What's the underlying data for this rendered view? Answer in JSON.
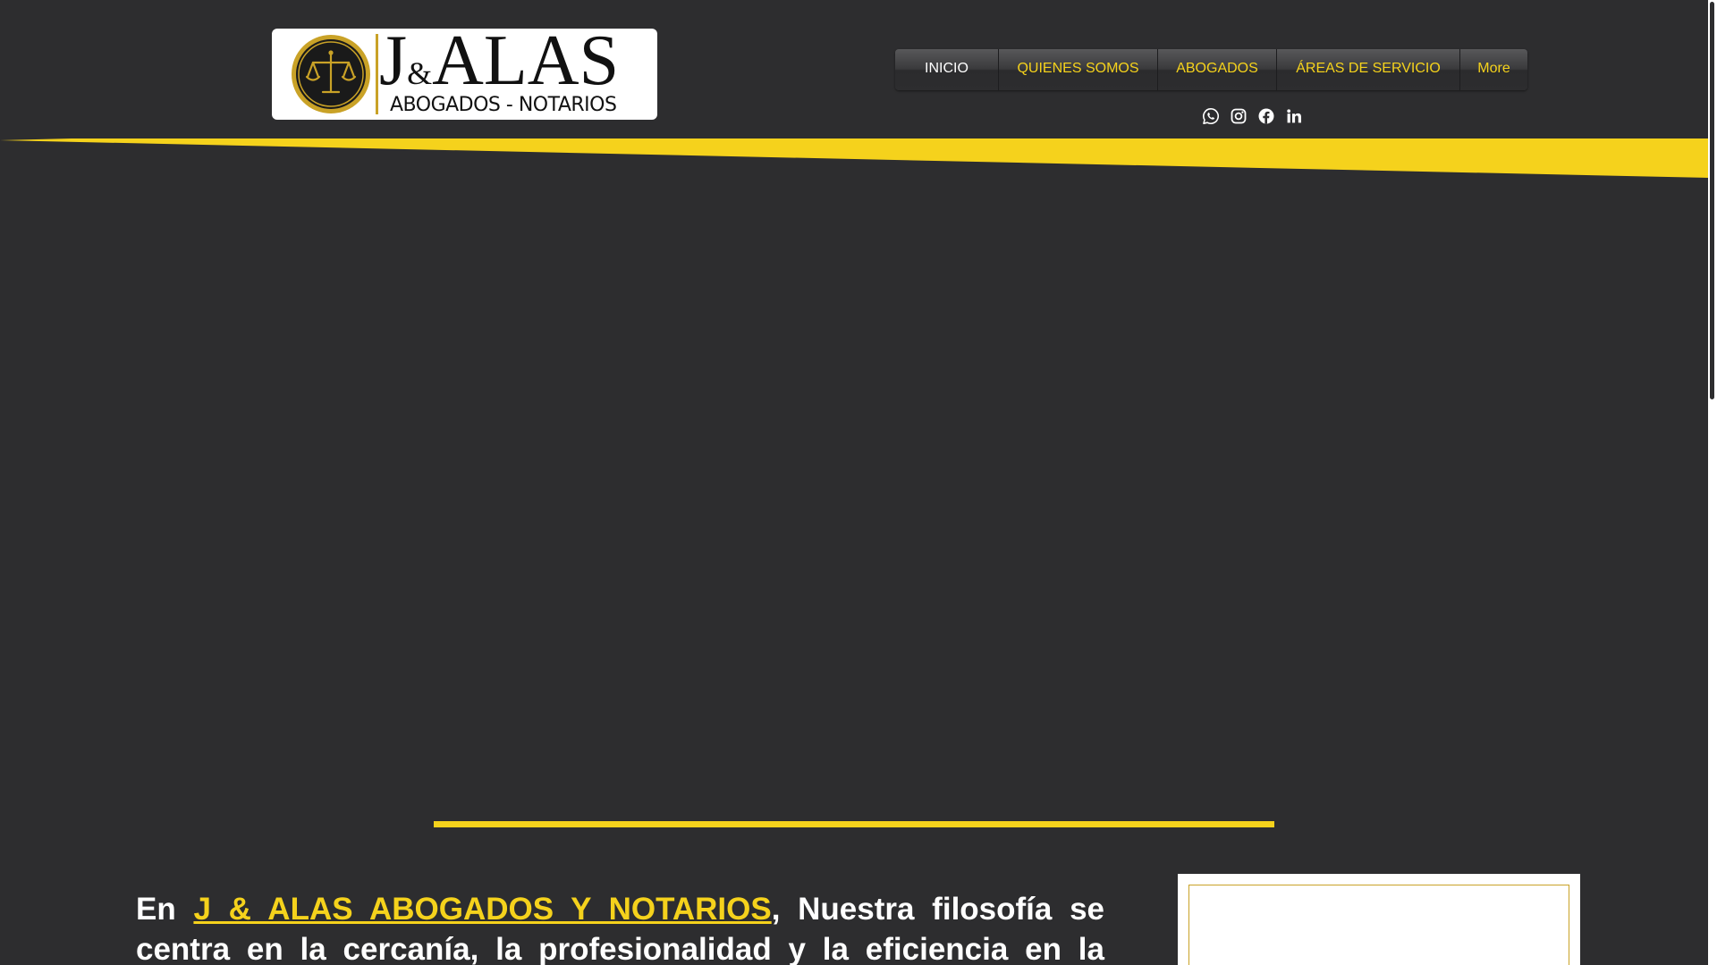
{
  "logo": {
    "main_j": "J",
    "main_amp": "&",
    "main_alas": "ALAS",
    "subtitle": "ABOGADOS - NOTARIOS"
  },
  "nav": {
    "items": [
      {
        "label": "INICIO",
        "active": true
      },
      {
        "label": "QUIENES SOMOS",
        "active": false
      },
      {
        "label": "ABOGADOS",
        "active": false
      },
      {
        "label": "ÁREAS DE SERVICIO",
        "active": false
      },
      {
        "label": "More",
        "active": false
      }
    ]
  },
  "social": [
    "whatsapp-icon",
    "instagram-icon",
    "facebook-icon",
    "linkedin-icon"
  ],
  "intro": {
    "prefix": "En ",
    "link": "J & ALAS ABOGADOS Y NOTARIOS",
    "suffix": ", Nuestra filosofía se centra en la cercanía, la profesionalidad y la eficiencia en la"
  },
  "colors": {
    "background": "#2d2d2f",
    "accent": "#f5d21c",
    "nav_active": "#ffffff",
    "logo_gold": "#c9a227"
  }
}
